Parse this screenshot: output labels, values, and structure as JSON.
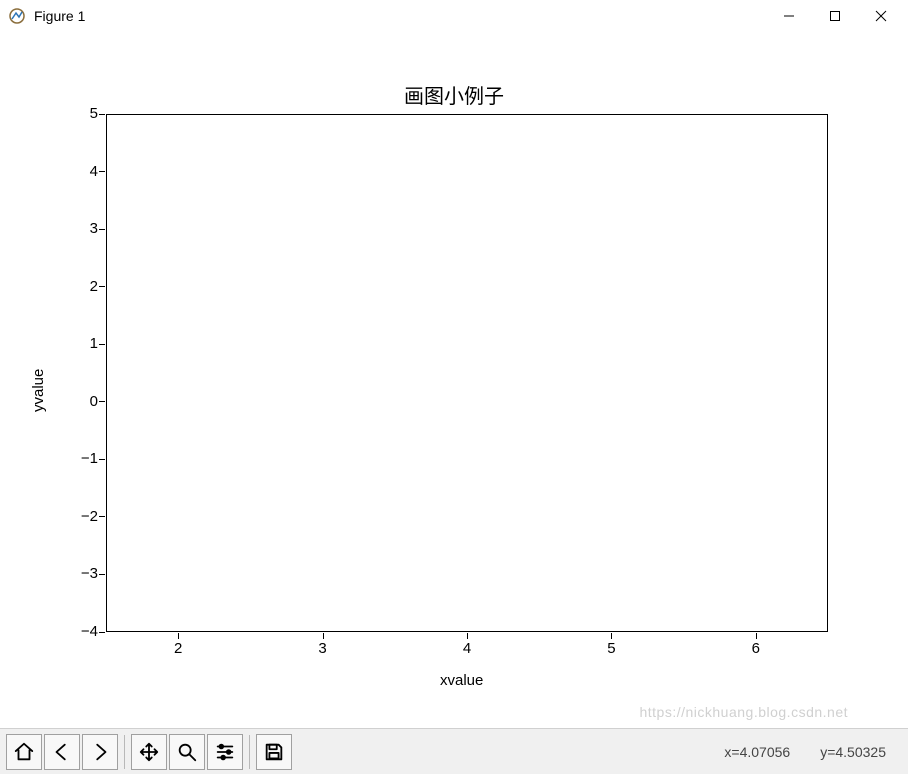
{
  "window": {
    "title": "Figure 1"
  },
  "chart_data": {
    "type": "line",
    "title": "画图小例子",
    "xlabel": "xvalue",
    "ylabel": "yvalue",
    "xticks": [
      2,
      3,
      4,
      5,
      6
    ],
    "yticks": [
      -4,
      -3,
      -2,
      -1,
      0,
      1,
      2,
      3,
      4,
      5
    ],
    "xlim": [
      1.5,
      6.5
    ],
    "ylim": [
      -4,
      5
    ],
    "series": []
  },
  "toolbar": {
    "home": "Home",
    "back": "Back",
    "forward": "Forward",
    "pan": "Pan",
    "zoom": "Zoom",
    "configure": "Configure subplots",
    "save": "Save"
  },
  "status": {
    "x_label": "x=4.07056",
    "y_label": "y=4.50325"
  },
  "watermark": "https://nickhuang.blog.csdn.net"
}
